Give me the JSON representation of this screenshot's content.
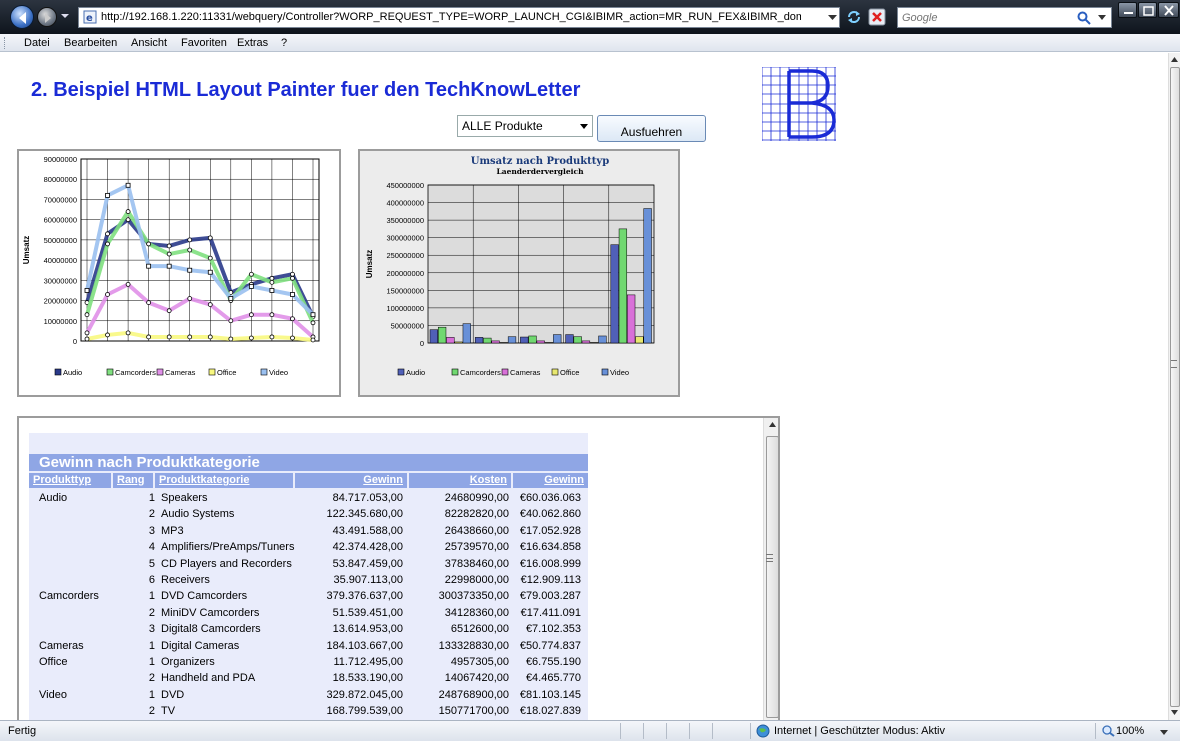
{
  "browser": {
    "url": "http://192.168.1.220:11331/webquery/Controller?WORP_REQUEST_TYPE=WORP_LAUNCH_CGI&IBIMR_action=MR_RUN_FEX&IBIMR_domain=techkı",
    "search_placeholder": "Google",
    "menu": [
      "Datei",
      "Bearbeiten",
      "Ansicht",
      "Favoriten",
      "Extras",
      "?"
    ]
  },
  "page": {
    "title": "2. Beispiel HTML Layout Painter fuer den TechKnowLetter",
    "select_value": "ALLE Produkte",
    "run_button": "Ausfuehren"
  },
  "chart_data": [
    {
      "type": "line",
      "title": "",
      "xlabel": "",
      "ylabel": "Umsatz",
      "ylim": [
        0,
        90000000
      ],
      "yticks": [
        "0",
        "10000000",
        "20000000",
        "30000000",
        "40000000",
        "50000000",
        "60000000",
        "70000000",
        "80000000",
        "90000000"
      ],
      "grid": true,
      "legend": "bottom",
      "series": [
        {
          "name": "Audio",
          "color": "#2a3a8a",
          "values": [
            19000000,
            53000000,
            60000000,
            48000000,
            47000000,
            50000000,
            51000000,
            24000000,
            28000000,
            31000000,
            33000000,
            12000000
          ]
        },
        {
          "name": "Camcorders",
          "color": "#80e080",
          "values": [
            13000000,
            48000000,
            64000000,
            48000000,
            43000000,
            45000000,
            41000000,
            20000000,
            33000000,
            29000000,
            31000000,
            9000000
          ]
        },
        {
          "name": "Cameras",
          "color": "#e090e8",
          "values": [
            4000000,
            23000000,
            28000000,
            19000000,
            15000000,
            21000000,
            18000000,
            10000000,
            13000000,
            13000000,
            11000000,
            2000000
          ]
        },
        {
          "name": "Office",
          "color": "#f8f880",
          "values": [
            1000000,
            3000000,
            4000000,
            2000000,
            2000000,
            2000000,
            2000000,
            1000000,
            1500000,
            2000000,
            1500000,
            500000
          ]
        },
        {
          "name": "Video",
          "color": "#9ac0f0",
          "values": [
            25000000,
            72000000,
            77000000,
            37000000,
            37000000,
            35000000,
            34000000,
            21000000,
            27000000,
            25000000,
            23000000,
            13000000
          ]
        }
      ]
    },
    {
      "type": "bar",
      "title": "Umsatz nach Produkttyp",
      "subtitle": "Laenderdervergleich",
      "xlabel": "",
      "ylabel": "Umsatz",
      "ylim": [
        0,
        450000000
      ],
      "yticks": [
        "0",
        "50000000",
        "100000000",
        "150000000",
        "200000000",
        "250000000",
        "300000000",
        "350000000",
        "400000000",
        "450000000"
      ],
      "grid": true,
      "legend": "bottom",
      "group_count": 5,
      "series": [
        {
          "name": "Audio",
          "color": "#5060b8",
          "values": [
            38000000,
            16000000,
            17000000,
            24000000,
            280000000
          ]
        },
        {
          "name": "Camcorders",
          "color": "#70d870",
          "values": [
            45000000,
            14000000,
            20000000,
            18000000,
            325000000
          ]
        },
        {
          "name": "Cameras",
          "color": "#d870d8",
          "values": [
            16000000,
            6000000,
            6000000,
            6000000,
            137000000
          ]
        },
        {
          "name": "Office",
          "color": "#e8e870",
          "values": [
            3000000,
            1500000,
            1500000,
            1500000,
            18000000
          ]
        },
        {
          "name": "Video",
          "color": "#6890d8",
          "values": [
            55000000,
            18000000,
            24000000,
            20000000,
            383000000
          ]
        }
      ]
    }
  ],
  "report": {
    "title": "Gewinn nach Produktkategorie",
    "headers": [
      "Produkttyp",
      "Rang",
      "Produktkategorie",
      "Gewinn",
      "Kosten",
      "Gewinn"
    ],
    "rows": [
      [
        "Audio",
        "1",
        "Speakers",
        "84.717.053,00",
        "24680990,00",
        "€60.036.063"
      ],
      [
        "",
        "2",
        "Audio Systems",
        "122.345.680,00",
        "82282820,00",
        "€40.062.860"
      ],
      [
        "",
        "3",
        "MP3",
        "43.491.588,00",
        "26438660,00",
        "€17.052.928"
      ],
      [
        "",
        "4",
        "Amplifiers/PreAmps/Tuners",
        "42.374.428,00",
        "25739570,00",
        "€16.634.858"
      ],
      [
        "",
        "5",
        "CD Players and Recorders",
        "53.847.459,00",
        "37838460,00",
        "€16.008.999"
      ],
      [
        "",
        "6",
        "Receivers",
        "35.907.113,00",
        "22998000,00",
        "€12.909.113"
      ],
      [
        "Camcorders",
        "1",
        "DVD Camcorders",
        "379.376.637,00",
        "300373350,00",
        "€79.003.287"
      ],
      [
        "",
        "2",
        "MiniDV Camcorders",
        "51.539.451,00",
        "34128360,00",
        "€17.411.091"
      ],
      [
        "",
        "3",
        "Digital8 Camcorders",
        "13.614.953,00",
        "6512600,00",
        "€7.102.353"
      ],
      [
        "Cameras",
        "1",
        "Digital Cameras",
        "184.103.667,00",
        "133328830,00",
        "€50.774.837"
      ],
      [
        "Office",
        "1",
        "Organizers",
        "11.712.495,00",
        "4957305,00",
        "€6.755.190"
      ],
      [
        "",
        "2",
        "Handheld and PDA",
        "18.533.190,00",
        "14067420,00",
        "€4.465.770"
      ],
      [
        "Video",
        "1",
        "DVD",
        "329.872.045,00",
        "248768900,00",
        "€81.103.145"
      ],
      [
        "",
        "2",
        "TV",
        "168.799.539,00",
        "150771700,00",
        "€18.027.839"
      ]
    ]
  },
  "status": {
    "text": "Fertig",
    "zone": "Internet | Geschützter Modus: Aktiv",
    "zoom": "100%"
  }
}
